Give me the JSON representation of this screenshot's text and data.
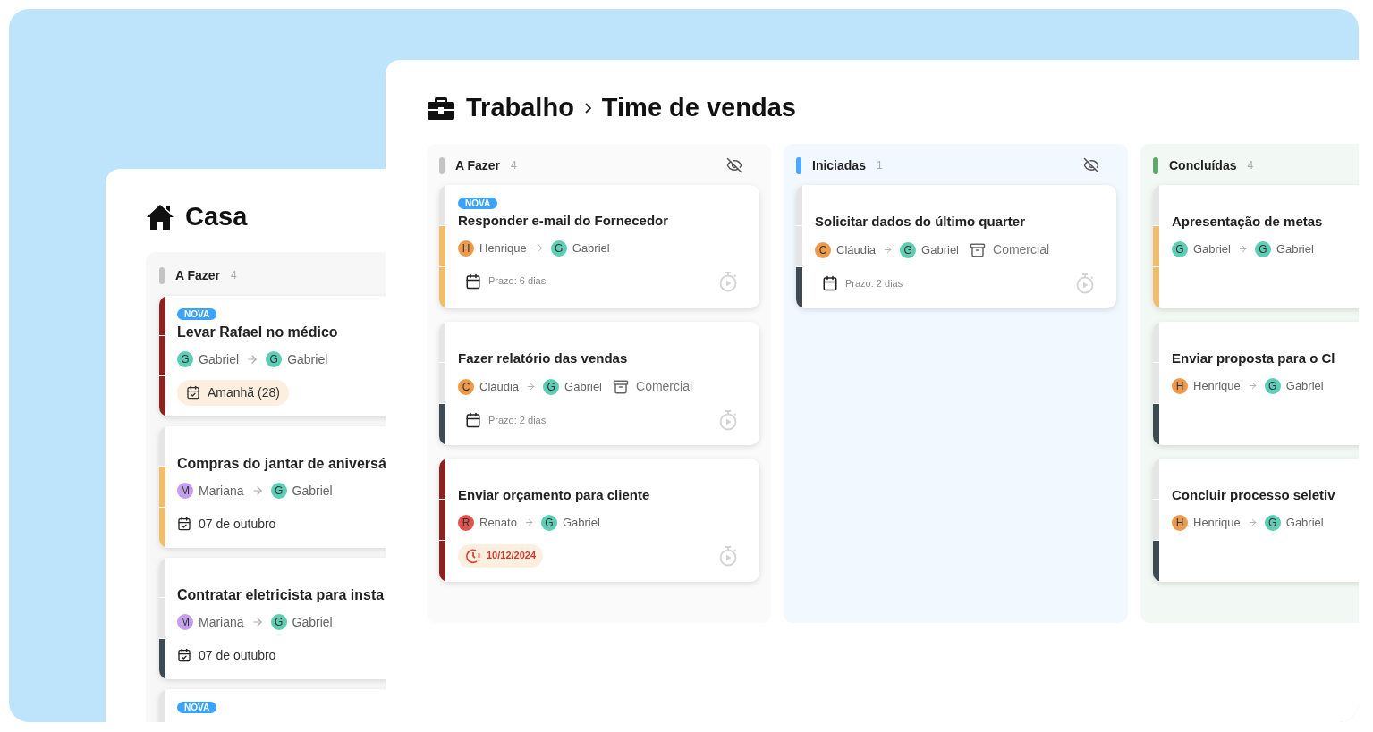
{
  "back_window": {
    "breadcrumb": [
      "Casa"
    ],
    "columns": [
      {
        "name": "A Fazer",
        "count": "4",
        "color": "#c4c4c4",
        "cards": [
          {
            "badge": "NOVA",
            "title": "Levar Rafael no médico",
            "from": {
              "initial": "G",
              "name": "Gabriel",
              "color": "#5dcdb6"
            },
            "to": {
              "initial": "G",
              "name": "Gabriel",
              "color": "#5dcdb6"
            },
            "due": {
              "kind": "soon",
              "text": "Amanhã (28)"
            },
            "kind": "high"
          },
          {
            "title": "Compras do jantar de aniversá",
            "from": {
              "initial": "M",
              "name": "Mariana",
              "color": "#c59ef0"
            },
            "to": {
              "initial": "G",
              "name": "Gabriel",
              "color": "#5dcdb6"
            },
            "due": {
              "kind": "date",
              "text": "07 de outubro"
            },
            "kind": "medium"
          },
          {
            "title": "Contratar eletricista para insta",
            "from": {
              "initial": "M",
              "name": "Mariana",
              "color": "#c59ef0"
            },
            "to": {
              "initial": "G",
              "name": "Gabriel",
              "color": "#5dcdb6"
            },
            "due": {
              "kind": "date",
              "text": "07 de outubro"
            },
            "kind": "low"
          },
          {
            "badge": "NOVA",
            "kind": "none"
          }
        ]
      }
    ]
  },
  "front_window": {
    "breadcrumb": [
      "Trabalho",
      "Time de vendas"
    ],
    "columns": [
      {
        "name": "A Fazer",
        "count": "4",
        "color": "#c4c4c4",
        "cards": [
          {
            "badge": "NOVA",
            "title": "Responder e-mail do Fornecedor",
            "from": {
              "initial": "H",
              "name": "Henrique",
              "color": "#ee9a4d"
            },
            "to": {
              "initial": "G",
              "name": "Gabriel",
              "color": "#5dcdb6"
            },
            "due": {
              "kind": "deadline",
              "text": "Prazo: 6 dias"
            },
            "kind": "medium"
          },
          {
            "title": "Fazer relatório das vendas",
            "from": {
              "initial": "C",
              "name": "Cláudia",
              "color": "#ee9a4d"
            },
            "to": {
              "initial": "G",
              "name": "Gabriel",
              "color": "#5dcdb6"
            },
            "tag": "Comercial",
            "due": {
              "kind": "deadline",
              "text": "Prazo: 2 dias"
            },
            "kind": "low"
          },
          {
            "title": "Enviar orçamento para cliente",
            "from": {
              "initial": "R",
              "name": "Renato",
              "color": "#e0544e"
            },
            "to": {
              "initial": "G",
              "name": "Gabriel",
              "color": "#5dcdb6"
            },
            "due": {
              "kind": "overdue",
              "text": "10/12/2024"
            },
            "kind": "high"
          }
        ]
      },
      {
        "name": "Iniciadas",
        "count": "1",
        "color": "#4aa8ff",
        "cards": [
          {
            "title": "Solicitar dados do último quarter",
            "from": {
              "initial": "C",
              "name": "Cláudia",
              "color": "#ee9a4d"
            },
            "to": {
              "initial": "G",
              "name": "Gabriel",
              "color": "#5dcdb6"
            },
            "tag": "Comercial",
            "due": {
              "kind": "deadline",
              "text": "Prazo: 2 dias"
            },
            "kind": "low"
          }
        ]
      },
      {
        "name": "Concluídas",
        "count": "4",
        "color": "#5fa86d",
        "cards": [
          {
            "title": "Apresentação de metas",
            "from": {
              "initial": "G",
              "name": "Gabriel",
              "color": "#5dcdb6"
            },
            "to": {
              "initial": "G",
              "name": "Gabriel",
              "color": "#5dcdb6"
            },
            "kind": "medium"
          },
          {
            "title": "Enviar proposta para o Cl",
            "from": {
              "initial": "H",
              "name": "Henrique",
              "color": "#ee9a4d"
            },
            "to": {
              "initial": "G",
              "name": "Gabriel",
              "color": "#5dcdb6"
            },
            "kind": "low"
          },
          {
            "title": "Concluir processo seletiv",
            "from": {
              "initial": "H",
              "name": "Henrique",
              "color": "#ee9a4d"
            },
            "to": {
              "initial": "G",
              "name": "Gabriel",
              "color": "#5dcdb6"
            },
            "kind": "low"
          }
        ]
      }
    ]
  }
}
